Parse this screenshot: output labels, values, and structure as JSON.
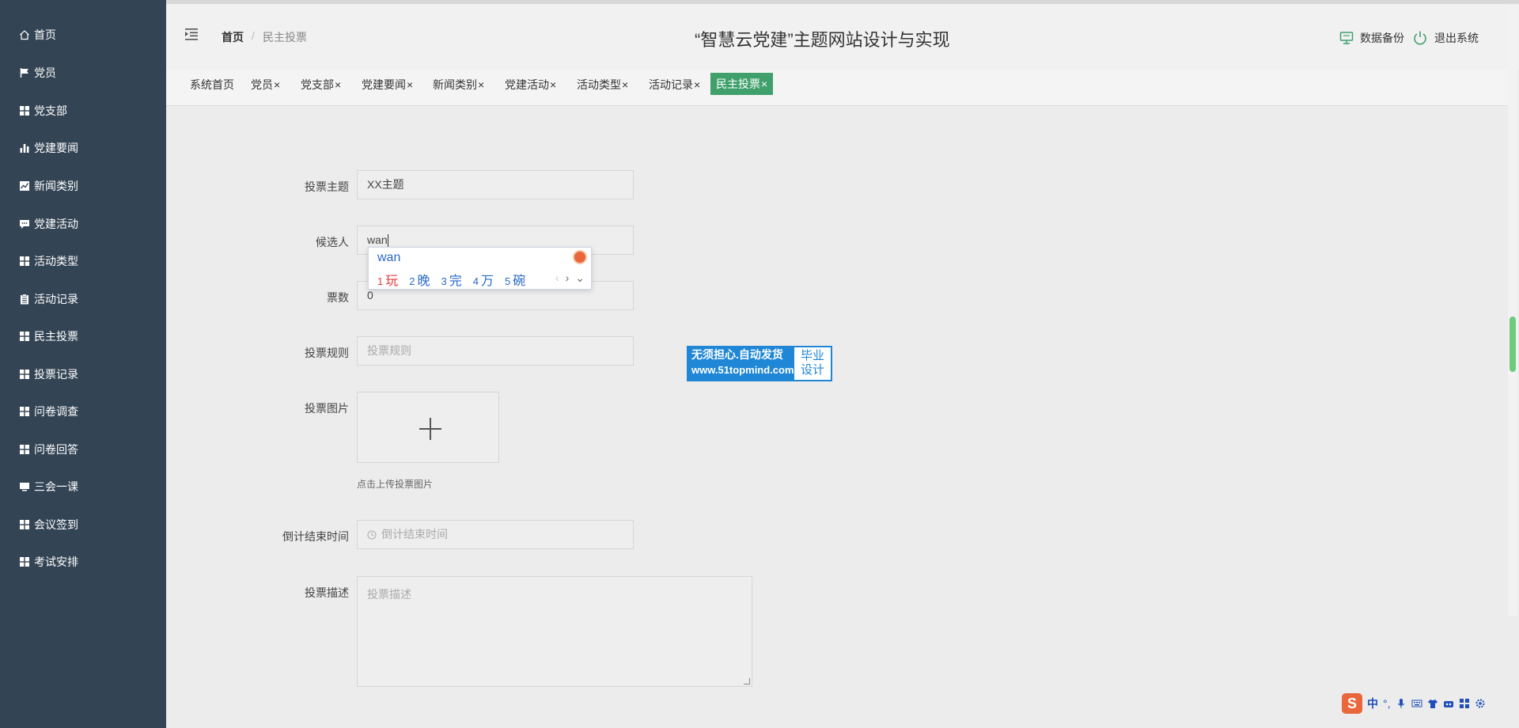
{
  "sidebar": {
    "items": [
      {
        "label": "首页",
        "icon": "home-icon"
      },
      {
        "label": "党员",
        "icon": "flag-icon"
      },
      {
        "label": "党支部",
        "icon": "grid-icon"
      },
      {
        "label": "党建要闻",
        "icon": "bar-chart-icon"
      },
      {
        "label": "新闻类别",
        "icon": "line-chart-icon"
      },
      {
        "label": "党建活动",
        "icon": "comment-icon"
      },
      {
        "label": "活动类型",
        "icon": "grid-icon"
      },
      {
        "label": "活动记录",
        "icon": "clipboard-icon"
      },
      {
        "label": "民主投票",
        "icon": "grid-icon"
      },
      {
        "label": "投票记录",
        "icon": "grid-icon"
      },
      {
        "label": "问卷调查",
        "icon": "grid-icon"
      },
      {
        "label": "问卷回答",
        "icon": "grid-icon"
      },
      {
        "label": "三会一课",
        "icon": "monitor-icon"
      },
      {
        "label": "会议签到",
        "icon": "grid-icon"
      },
      {
        "label": "考试安排",
        "icon": "grid-icon"
      }
    ]
  },
  "header": {
    "breadcrumb_home": "首页",
    "breadcrumb_sep": "/",
    "breadcrumb_current": "民主投票",
    "title": "“智慧云党建”主题网站设计与实现",
    "backup_label": "数据备份",
    "logout_label": "退出系统"
  },
  "tabs": [
    {
      "label": "系统首页",
      "closable": false
    },
    {
      "label": "党员",
      "closable": true
    },
    {
      "label": "党支部",
      "closable": true
    },
    {
      "label": "党建要闻",
      "closable": true
    },
    {
      "label": "新闻类别",
      "closable": true
    },
    {
      "label": "党建活动",
      "closable": true
    },
    {
      "label": "活动类型",
      "closable": true
    },
    {
      "label": "活动记录",
      "closable": true
    },
    {
      "label": "民主投票",
      "closable": true,
      "active": true
    }
  ],
  "tab_close": "×",
  "form": {
    "topic_label": "投票主题",
    "topic_value": "XX主题",
    "candidate_label": "候选人",
    "candidate_value": "wan",
    "votes_label": "票数",
    "votes_value": "0",
    "rules_label": "投票规则",
    "rules_placeholder": "投票规则",
    "image_label": "投票图片",
    "image_hint": "点击上传投票图片",
    "countdown_label": "倒计结束时间",
    "countdown_placeholder": "倒计结束时间",
    "desc_label": "投票描述",
    "desc_placeholder": "投票描述"
  },
  "ime": {
    "composition": "wan",
    "candidates": [
      {
        "n": "1",
        "text": "玩"
      },
      {
        "n": "2",
        "text": "晚"
      },
      {
        "n": "3",
        "text": "完"
      },
      {
        "n": "4",
        "text": "万"
      },
      {
        "n": "5",
        "text": "碗"
      }
    ],
    "prev": "‹",
    "next": "›",
    "expand": "⌄"
  },
  "ad": {
    "line1": "无须担心.自动发货",
    "line2": "www.51topmind.com",
    "right1": "毕业",
    "right2": "设计"
  },
  "tray": {
    "logo": "S",
    "mode": "中",
    "punct": "°,"
  },
  "colors": {
    "sidebar_bg": "#334454",
    "active_tab": "#3fa06c",
    "ime_text": "#2a6ac8",
    "ime_first": "#e4393c"
  }
}
